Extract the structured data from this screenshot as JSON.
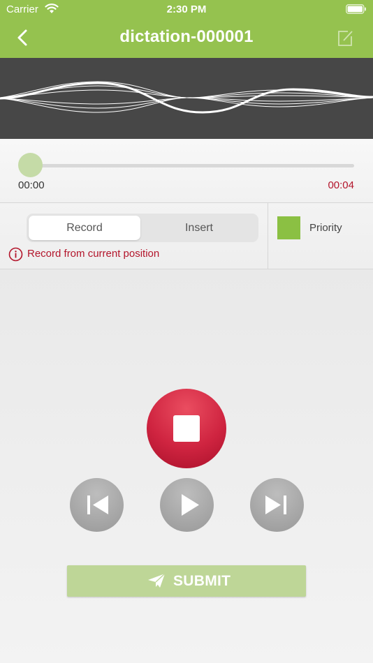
{
  "status_bar": {
    "carrier": "Carrier",
    "time": "2:30 PM"
  },
  "nav": {
    "title": "dictation-000001",
    "back_icon": "chevron-left-icon",
    "edit_icon": "compose-icon"
  },
  "player": {
    "time_start": "00:00",
    "time_end": "00:04",
    "progress": 0.0
  },
  "mode": {
    "options": [
      "Record",
      "Insert"
    ],
    "selected": "Record",
    "hint": "Record from current position"
  },
  "priority": {
    "label": "Priority"
  },
  "controls": {
    "record_icon": "stop-icon",
    "skip_back_icon": "skip-back-icon",
    "play_icon": "play-icon",
    "skip_forward_icon": "skip-forward-icon"
  },
  "submit": {
    "label": "SUBMIT",
    "icon": "paper-plane-icon"
  },
  "colors": {
    "brand_green": "#95c24f",
    "priority_green": "#8bc043",
    "record_red": "#cf2440",
    "accent_red": "#b3152b",
    "submit_disabled": "#bed697"
  }
}
